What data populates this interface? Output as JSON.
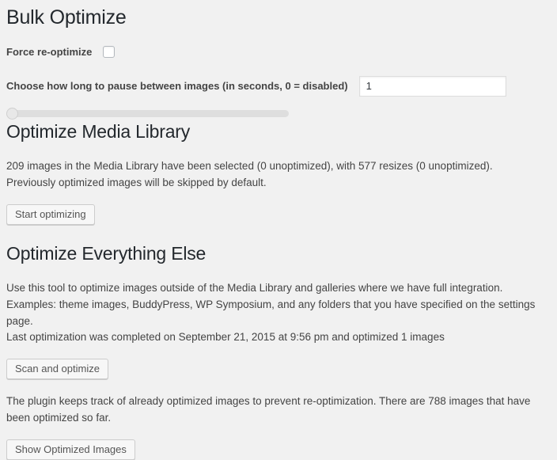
{
  "page": {
    "title": "Bulk Optimize"
  },
  "force_reoptimize": {
    "label": "Force re-optimize",
    "checked": false
  },
  "delay": {
    "label": "Choose how long to pause between images (in seconds, 0 = disabled)",
    "value": "1",
    "placeholder": "",
    "slider_position_percent": 0
  },
  "media_library": {
    "heading": "Optimize Media Library",
    "status_line_1": "209 images in the Media Library have been selected (0 unoptimized), with 577 resizes (0 unoptimized).",
    "status_line_2": "Previously optimized images will be skipped by default.",
    "start_button": "Start optimizing",
    "images_selected": 209,
    "images_unoptimized": 0,
    "resizes": 577,
    "resizes_unoptimized": 0
  },
  "everything_else": {
    "heading": "Optimize Everything Else",
    "description": "Use this tool to optimize images outside of the Media Library and galleries where we have full integration. Examples: theme images, BuddyPress, WP Symposium, and any folders that you have specified on the settings page.",
    "last_optimization": "Last optimization was completed on September 21, 2015 at 9:56 pm and optimized 1 images",
    "scan_button": "Scan and optimize",
    "tracking_note": "The plugin keeps track of already optimized images to prevent re-optimization. There are 788 images that have been optimized so far.",
    "show_button": "Show Optimized Images",
    "optimized_count": 788
  },
  "colors": {
    "page_background": "#f1f1f1",
    "heading_text": "#23282d",
    "body_text": "#444444",
    "button_background": "#f7f7f7",
    "button_border": "#cccccc",
    "input_border": "#dddddd",
    "slider_track": "#dedede"
  }
}
